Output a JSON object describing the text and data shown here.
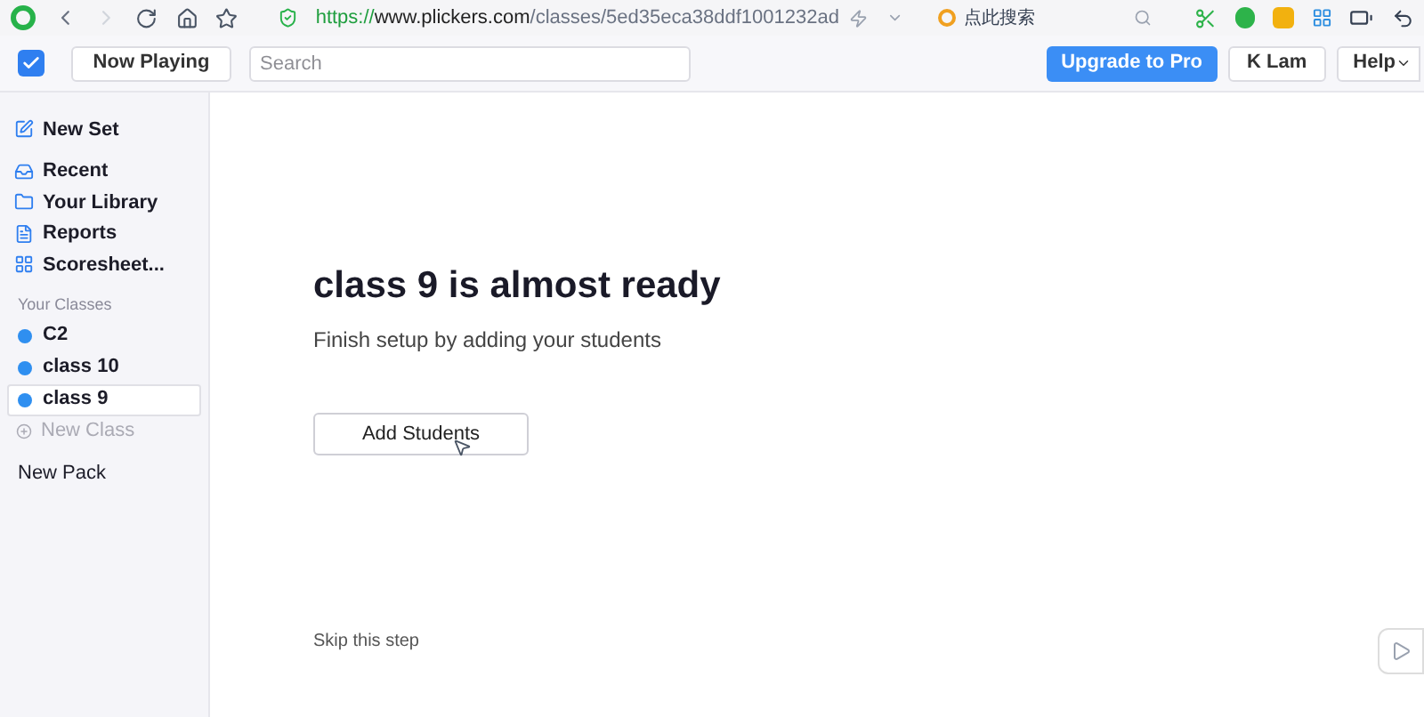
{
  "browser": {
    "url_scheme": "https://",
    "url_host": "www.plickers.com",
    "url_path": "/classes/5ed35eca38ddf1001232ad",
    "search_placeholder": "点此搜索"
  },
  "toolbar": {
    "now_playing": "Now Playing",
    "search_placeholder": "Search",
    "upgrade": "Upgrade to Pro",
    "user": "K Lam",
    "help": "Help"
  },
  "sidebar": {
    "items": [
      {
        "label": "New Set"
      },
      {
        "label": "Recent"
      },
      {
        "label": "Your Library"
      },
      {
        "label": "Reports"
      },
      {
        "label": "Scoresheet..."
      }
    ],
    "classes_heading": "Your Classes",
    "classes": [
      {
        "label": "C2",
        "selected": false,
        "color": "#2f8ff0"
      },
      {
        "label": "class 10",
        "selected": false,
        "color": "#2f8ff0"
      },
      {
        "label": "class 9",
        "selected": true,
        "color": "#2f8ff0"
      }
    ],
    "new_class": "New Class",
    "new_pack": "New Pack"
  },
  "main": {
    "title": "class 9 is almost ready",
    "subtitle": "Finish setup by adding your students",
    "button": "Add Students",
    "skip": "Skip this step"
  }
}
